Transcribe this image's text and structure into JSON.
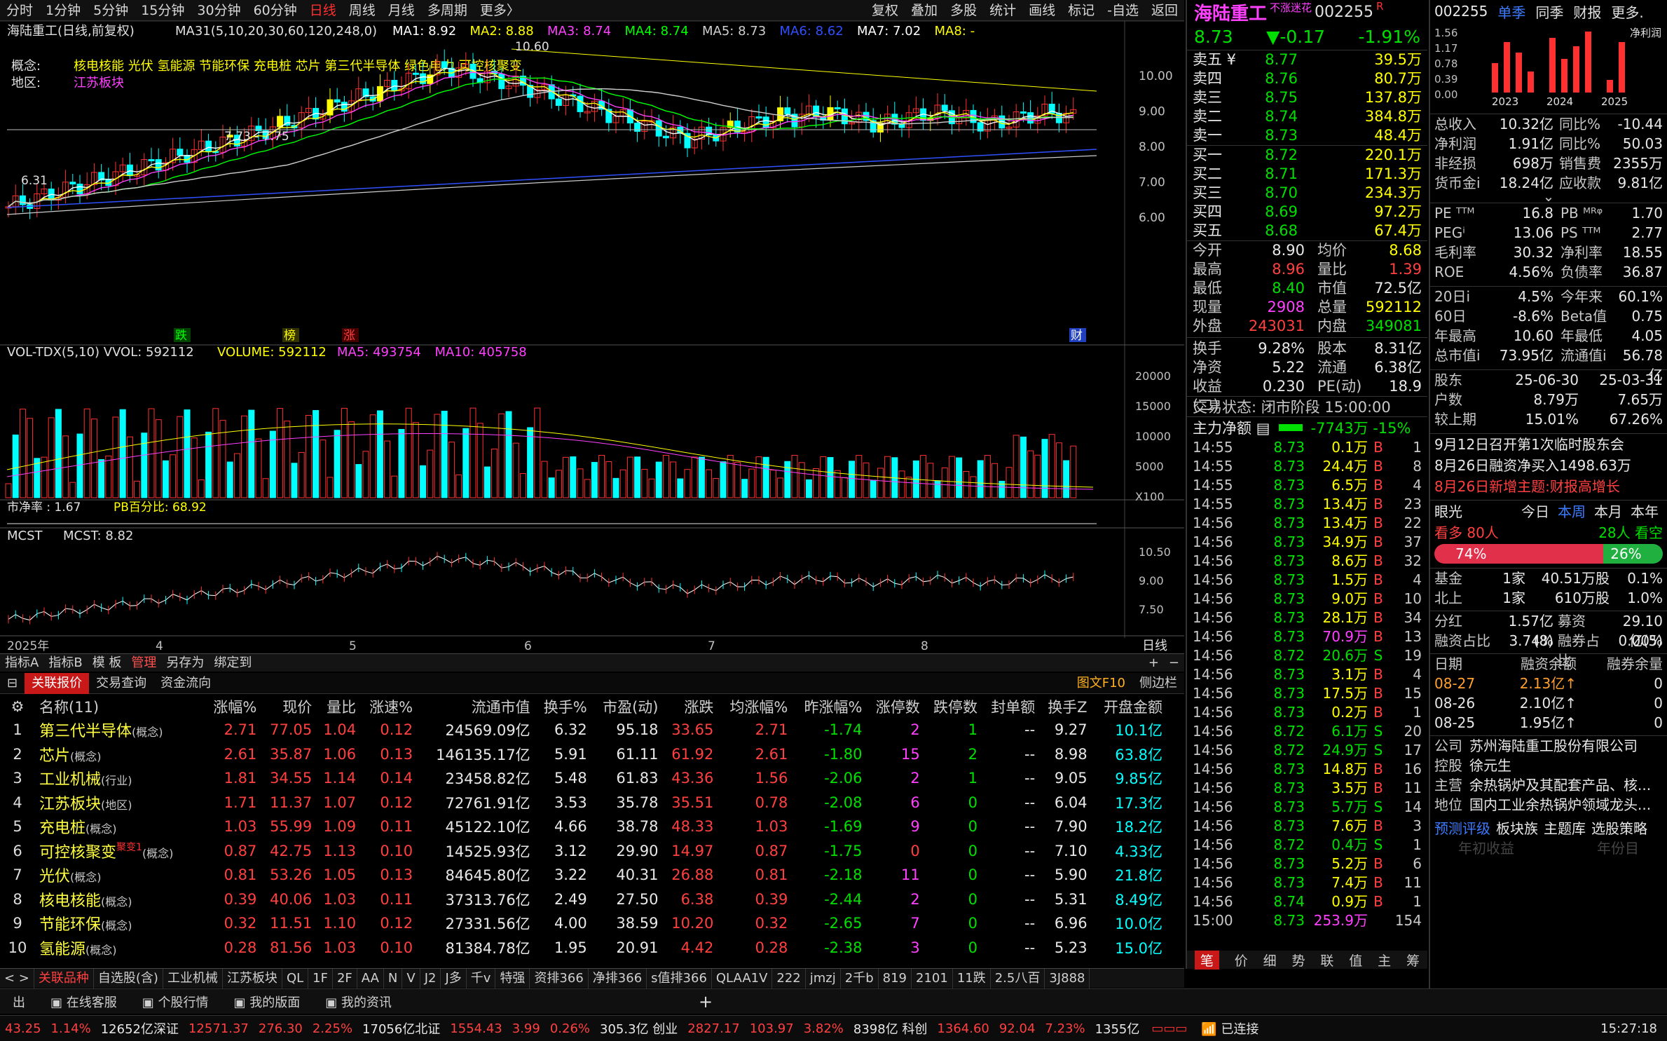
{
  "menu": {
    "items": [
      "分时",
      "1分钟",
      "5分钟",
      "15分钟",
      "30分钟",
      "60分钟",
      "日线",
      "周线",
      "月线",
      "多周期",
      "更多〉"
    ],
    "active": "日线",
    "right": [
      "复权",
      "叠加",
      "多股",
      "统计",
      "画线",
      "标记",
      "-自选",
      "返回"
    ]
  },
  "chart": {
    "title": "海陆重工(日线,前复权)",
    "ma_label": "MA31(5,10,20,30,60,120,248,0)",
    "ma_values": [
      {
        "t": "MA1: 8.92",
        "c": "#ffffff"
      },
      {
        "t": "MA2: 8.88",
        "c": "#ffff00"
      },
      {
        "t": "MA3: 8.74",
        "c": "#ff40ff"
      },
      {
        "t": "MA4: 8.74",
        "c": "#00ff00"
      },
      {
        "t": "MA5: 8.73",
        "c": "#cfcfcf"
      },
      {
        "t": "MA6: 8.62",
        "c": "#3050ff"
      },
      {
        "t": "MA7: 7.02",
        "c": "#ffffff"
      },
      {
        "t": "MA8: -",
        "c": "#ffff00"
      }
    ],
    "concept_label": "概念:",
    "concepts": "核电核能 光伏 氢能源 节能环保 充电桩 芯片 第三代半导体 绿色电力 可控核聚变",
    "region_label": "地区:",
    "region": "江苏板块",
    "y_labels": [
      "10.00",
      "9.00",
      "8.00",
      "7.00",
      "6.00"
    ],
    "annotations": {
      "high": "10.60",
      "mid": "7.73 - 7.75",
      "low": "6.31"
    },
    "markers": [
      "跌",
      "榜",
      "涨",
      "财"
    ],
    "vol_title": "VOL-TDX(5,10) VVOL: 592112",
    "vol_fields": [
      {
        "t": "VOLUME: 592112",
        "c": "#ffff00"
      },
      {
        "t": "MA5: 493754",
        "c": "#ff40ff"
      },
      {
        "t": "MA10: 405758",
        "c": "#ff40ff"
      }
    ],
    "vol_y": [
      "20000",
      "15000",
      "10000",
      "5000",
      "X100"
    ],
    "pb_title": "市净率 : 1.67",
    "pb_field": "PB百分比: 68.92",
    "mcst_title": "MCST",
    "mcst_field": "MCST: 8.82",
    "mcst_y": [
      "10.50",
      "9.00",
      "7.50"
    ],
    "x_labels": [
      "2025年",
      "4",
      "5",
      "6",
      "7",
      "8"
    ],
    "period": "日线"
  },
  "ind_tabs": {
    "items": [
      "指标A",
      "指标B",
      "模 板",
      "管理",
      "另存为",
      "绑定到"
    ],
    "active": "管理",
    "right": [
      "+",
      "−"
    ]
  },
  "tbl_tabs": {
    "items": [
      "关联报价",
      "交易查询",
      "资金流向"
    ],
    "active": "关联报价",
    "right": [
      "图文F10",
      "侧边栏"
    ]
  },
  "table": {
    "headers": [
      "名称(11)",
      "涨幅%",
      "现价",
      "量比",
      "涨速%",
      "流通市值",
      "换手%",
      "市盈(动)",
      "涨跌",
      "均涨幅%",
      "昨涨幅%",
      "涨停数",
      "跌停数",
      "封单额",
      "换手Z",
      "开盘金额"
    ],
    "rows": [
      [
        "1",
        "第三代半导体",
        "(概念)",
        "2.71",
        "77.05",
        "1.04",
        "0.12",
        "24569.09亿",
        "6.32",
        "95.18",
        "33.65",
        "2.71",
        "-1.74",
        "2",
        "1",
        "--",
        "9.27",
        "10.1亿"
      ],
      [
        "2",
        "芯片",
        "(概念)",
        "2.61",
        "35.87",
        "1.06",
        "0.13",
        "146135.17亿",
        "5.91",
        "61.11",
        "61.92",
        "2.61",
        "-1.80",
        "15",
        "2",
        "--",
        "8.98",
        "63.8亿"
      ],
      [
        "3",
        "工业机械",
        "(行业)",
        "1.81",
        "34.55",
        "1.14",
        "0.14",
        "23458.82亿",
        "5.48",
        "61.83",
        "43.36",
        "1.56",
        "-2.06",
        "2",
        "1",
        "--",
        "9.05",
        "9.85亿"
      ],
      [
        "4",
        "江苏板块",
        "(地区)",
        "1.71",
        "11.37",
        "1.07",
        "0.12",
        "72761.91亿",
        "3.53",
        "35.78",
        "35.51",
        "0.78",
        "-2.08",
        "6",
        "0",
        "--",
        "6.04",
        "17.3亿"
      ],
      [
        "5",
        "充电桩",
        "(概念)",
        "1.03",
        "55.99",
        "1.09",
        "0.11",
        "45122.10亿",
        "4.66",
        "38.78",
        "48.33",
        "1.03",
        "-1.69",
        "9",
        "0",
        "--",
        "7.90",
        "18.2亿"
      ],
      [
        "6",
        "可控核聚变",
        "(概念)",
        "0.87",
        "42.75",
        "1.13",
        "0.10",
        "14525.93亿",
        "3.12",
        "29.90",
        "14.97",
        "0.87",
        "-1.75",
        "0",
        "0",
        "--",
        "7.10",
        "4.33亿"
      ],
      [
        "7",
        "光伏",
        "(概念)",
        "0.81",
        "53.26",
        "1.05",
        "0.13",
        "84645.80亿",
        "3.22",
        "40.31",
        "26.88",
        "0.81",
        "-2.18",
        "11",
        "0",
        "--",
        "5.90",
        "21.8亿"
      ],
      [
        "8",
        "核电核能",
        "(概念)",
        "0.39",
        "40.06",
        "1.03",
        "0.11",
        "37313.76亿",
        "2.49",
        "27.50",
        "6.38",
        "0.39",
        "-2.44",
        "2",
        "0",
        "--",
        "5.31",
        "8.49亿"
      ],
      [
        "9",
        "节能环保",
        "(概念)",
        "0.32",
        "11.51",
        "1.10",
        "0.12",
        "27331.56亿",
        "4.00",
        "38.59",
        "10.20",
        "0.32",
        "-2.65",
        "7",
        "0",
        "--",
        "6.96",
        "10.0亿"
      ],
      [
        "10",
        "氢能源",
        "(概念)",
        "0.28",
        "81.56",
        "1.03",
        "0.10",
        "81384.78亿",
        "1.95",
        "20.91",
        "4.42",
        "0.28",
        "-2.38",
        "3",
        "0",
        "--",
        "5.23",
        "15.0亿"
      ]
    ],
    "badge": "聚变1"
  },
  "bottom_tabs": {
    "items": [
      "关联品种",
      "自选股(含)",
      "工业机械",
      "江苏板块",
      "QL",
      "1F",
      "2F",
      "AA",
      "N",
      "V",
      "J2",
      "J多",
      "千v",
      "特强",
      "资排366",
      "净排366",
      "s值排366",
      "QLAA1V",
      "222",
      "jmzj",
      "2千b",
      "819",
      "2101",
      "11跌",
      "2.5八百",
      "3J888"
    ],
    "active": "关联品种"
  },
  "footer1": {
    "items": [
      "出",
      "在线客服",
      "个股行情",
      "我的版面",
      "我的资讯"
    ],
    "plus": "+"
  },
  "footer2": {
    "items": [
      {
        "t": "43.25",
        "c": "red"
      },
      {
        "t": "1.14%",
        "c": "red"
      },
      {
        "t": "12652亿深证",
        "c": "white"
      },
      {
        "t": "12571.37",
        "c": "red"
      },
      {
        "t": "276.30",
        "c": "red"
      },
      {
        "t": "2.25%",
        "c": "red"
      },
      {
        "t": "17056亿北证",
        "c": "white"
      },
      {
        "t": "1554.43",
        "c": "red"
      },
      {
        "t": "3.99",
        "c": "red"
      },
      {
        "t": "0.26%",
        "c": "red"
      },
      {
        "t": "305.3亿 创业",
        "c": "white"
      },
      {
        "t": "2827.17",
        "c": "red"
      },
      {
        "t": "103.97",
        "c": "red"
      },
      {
        "t": "3.82%",
        "c": "red"
      },
      {
        "t": "8398亿 科创",
        "c": "white"
      },
      {
        "t": "1364.60",
        "c": "red"
      },
      {
        "t": "92.04",
        "c": "red"
      },
      {
        "t": "7.23%",
        "c": "red"
      },
      {
        "t": "1355亿",
        "c": "white"
      }
    ],
    "status": "已连接",
    "time": "15:27:18"
  },
  "quote": {
    "name": "海陆重工",
    "tag": "不涨迷花",
    "code": "002255",
    "flag": "R",
    "price": "8.73",
    "change": "▼-0.17",
    "pct": "-1.91%",
    "asks": [
      [
        "卖五",
        "¥",
        "8.77",
        "39.5万"
      ],
      [
        "卖四",
        "",
        "8.76",
        "80.7万"
      ],
      [
        "卖三",
        "",
        "8.75",
        "137.8万"
      ],
      [
        "卖二",
        "",
        "8.74",
        "384.8万"
      ],
      [
        "卖一",
        "",
        "8.73",
        "48.4万"
      ]
    ],
    "bids": [
      [
        "买一",
        "8.72",
        "220.1万"
      ],
      [
        "买二",
        "8.71",
        "171.3万"
      ],
      [
        "买三",
        "8.70",
        "234.3万"
      ],
      [
        "买四",
        "8.69",
        "97.2万"
      ],
      [
        "买五",
        "8.68",
        "67.4万"
      ]
    ],
    "stats": [
      [
        "今开",
        "8.90",
        "均价",
        "8.68"
      ],
      [
        "最高",
        "8.96",
        "量比",
        "1.39"
      ],
      [
        "最低",
        "8.40",
        "市值",
        "72.5亿"
      ],
      [
        "现量",
        "2908",
        "总量",
        "592112"
      ],
      [
        "外盘",
        "243031",
        "内盘",
        "349081"
      ],
      [
        "换手",
        "9.28%",
        "股本",
        "8.31亿"
      ],
      [
        "净资",
        "5.22",
        "流通",
        "6.38亿"
      ],
      [
        "收益(二)",
        "0.230",
        "PE(动)",
        "18.9"
      ]
    ],
    "status": "交易状态: 闭市阶段 15:00:00",
    "flow_label": "主力净额",
    "flow_value": "-7743万 -15%",
    "ticks": [
      [
        "14:55",
        "8.73",
        "0.1万",
        "B",
        "1"
      ],
      [
        "14:55",
        "8.73",
        "24.4万",
        "B",
        "8"
      ],
      [
        "14:55",
        "8.73",
        "6.5万",
        "B",
        "4"
      ],
      [
        "14:55",
        "8.73",
        "13.4万",
        "B",
        "23"
      ],
      [
        "14:56",
        "8.73",
        "13.4万",
        "B",
        "22"
      ],
      [
        "14:56",
        "8.73",
        "34.9万",
        "B",
        "37"
      ],
      [
        "14:56",
        "8.73",
        "8.6万",
        "B",
        "32"
      ],
      [
        "14:56",
        "8.73",
        "1.5万",
        "B",
        "4"
      ],
      [
        "14:56",
        "8.73",
        "9.0万",
        "B",
        "10"
      ],
      [
        "14:56",
        "8.73",
        "28.1万",
        "B",
        "34"
      ],
      [
        "14:56",
        "8.73",
        "70.9万",
        "B",
        "13"
      ],
      [
        "14:56",
        "8.72",
        "20.6万",
        "S",
        "19"
      ],
      [
        "14:56",
        "8.73",
        "3.1万",
        "B",
        "4"
      ],
      [
        "14:56",
        "8.73",
        "17.5万",
        "B",
        "15"
      ],
      [
        "14:56",
        "8.73",
        "0.2万",
        "B",
        "1"
      ],
      [
        "14:56",
        "8.72",
        "6.1万",
        "S",
        "20"
      ],
      [
        "14:56",
        "8.72",
        "24.9万",
        "S",
        "17"
      ],
      [
        "14:56",
        "8.73",
        "14.8万",
        "B",
        "16"
      ],
      [
        "14:56",
        "8.73",
        "3.5万",
        "B",
        "11"
      ],
      [
        "14:56",
        "8.73",
        "5.7万",
        "S",
        "14"
      ],
      [
        "14:56",
        "8.73",
        "7.6万",
        "B",
        "3"
      ],
      [
        "14:56",
        "8.72",
        "0.4万",
        "S",
        "1"
      ],
      [
        "14:56",
        "8.73",
        "5.2万",
        "B",
        "6"
      ],
      [
        "14:56",
        "8.73",
        "7.4万",
        "B",
        "11"
      ],
      [
        "14:56",
        "8.74",
        "0.9万",
        "B",
        "1"
      ],
      [
        "15:00",
        "8.73",
        "253.9万",
        "",
        "154"
      ]
    ],
    "bottom_tabs": [
      "笔",
      "价",
      "细",
      "势",
      "联",
      "值",
      "主",
      "筹"
    ]
  },
  "info": {
    "code": "002255",
    "tabs": [
      "单季",
      "同季",
      "财报",
      "更多."
    ],
    "chart_label": "净利润",
    "years": [
      "2023",
      "2024",
      "2025"
    ],
    "y_axis": [
      "1.56",
      "1.17",
      "0.78",
      "0.39",
      "0.00"
    ],
    "bars": [
      0.7,
      1.2,
      0.95,
      0.5,
      1.3,
      0.8,
      1.1,
      1.45,
      0.3,
      1.2
    ],
    "fin": [
      [
        "总收入",
        "10.32亿",
        "同比%",
        "-10.44"
      ],
      [
        "净利润",
        "1.91亿",
        "同比%",
        "50.03"
      ],
      [
        "非经损",
        "698万",
        "销售费",
        "2355万"
      ],
      [
        "货币金i",
        "18.24亿",
        "应收款",
        "9.81亿"
      ]
    ],
    "val": [
      [
        "PE ᵀᵀᴹ",
        "16.8",
        "PB ᴹᴿᵠ",
        "1.70"
      ],
      [
        "PEGⁱ",
        "13.06",
        "PS ᵀᵀᴹ",
        "2.77"
      ],
      [
        "毛利率",
        "30.32",
        "净利率",
        "18.55"
      ],
      [
        "ROE",
        "4.56%",
        "负债率",
        "36.87"
      ]
    ],
    "perf": [
      [
        "20日i",
        "4.5%",
        "今年来",
        "60.1%"
      ],
      [
        "60日",
        "-8.6%",
        "Beta值",
        "0.75"
      ],
      [
        "年最高",
        "10.60",
        "年最低",
        "4.05"
      ],
      [
        "总市值i",
        "73.95亿",
        "流通值i",
        "56.78亿"
      ]
    ],
    "holders": [
      [
        "股东",
        "25-06-30",
        "25-03-31"
      ],
      [
        "户数",
        "8.79万",
        "7.65万"
      ],
      [
        "较上期",
        "15.01%",
        "67.26%"
      ]
    ],
    "news": [
      {
        "t": "9月12日召开第1次临时股东会",
        "c": "#e8e8e8"
      },
      {
        "t": "8月26日融资净买入1498.63万",
        "c": "#e8e8e8"
      },
      {
        "t": "8月26日新增主题:财报高增长",
        "c": "#ff4040"
      }
    ],
    "eye": {
      "label": "眼光",
      "tabs": [
        "今日",
        "本周",
        "本月",
        "本年"
      ],
      "active": "本周",
      "bull": "看多 80人",
      "bear": "28人 看空",
      "bull_pct": "74%",
      "bear_pct": "26%",
      "bull_value": 0.74
    },
    "funds": [
      [
        "基金",
        "1家",
        "40.51万股",
        "0.1%"
      ],
      [
        "北上",
        "1家",
        "610万股",
        "1.0%"
      ]
    ],
    "margin": [
      [
        "分红",
        "1.57亿(8)",
        "募资",
        "29.10亿(5)"
      ],
      [
        "融资占比",
        "3.74%",
        "融券占比",
        "0.00%"
      ]
    ],
    "margin_tbl": {
      "headers": [
        "日期",
        "融资余额",
        "融券余量"
      ],
      "rows": [
        [
          "08-27",
          "2.13亿↑",
          "0"
        ],
        [
          "08-26",
          "2.10亿↑",
          "0"
        ],
        [
          "08-25",
          "1.95亿↑",
          "0"
        ]
      ]
    },
    "company": [
      [
        "公司",
        "苏州海陆重工股份有限公司"
      ],
      [
        "控股",
        "徐元生"
      ],
      [
        "主营",
        "余热锅炉及其配套产品、核..."
      ],
      [
        "地位",
        "国内工业余热锅炉领域龙头..."
      ]
    ],
    "links": [
      "预测评级",
      "板块族",
      "主题库",
      "选股策略"
    ],
    "ghost": [
      "年初收益",
      "年份目"
    ]
  }
}
